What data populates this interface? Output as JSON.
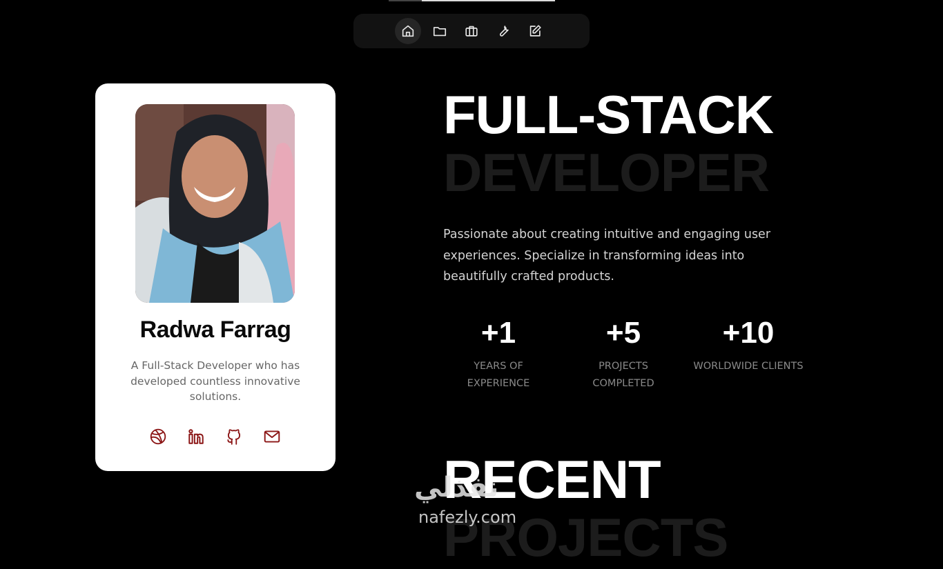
{
  "nav": {
    "items": [
      {
        "icon": "home-icon",
        "active": true
      },
      {
        "icon": "folder-icon",
        "active": false
      },
      {
        "icon": "briefcase-icon",
        "active": false
      },
      {
        "icon": "wrench-icon",
        "active": false
      },
      {
        "icon": "edit-icon",
        "active": false
      }
    ]
  },
  "profile": {
    "name": "Radwa Farrag",
    "bio": "A Full-Stack Developer who has developed countless innovative solutions.",
    "socials": [
      "dribbble-icon",
      "linkedin-icon",
      "github-icon",
      "mail-icon"
    ],
    "social_color": "#8b1515"
  },
  "hero": {
    "title_line1": "FULL-STACK",
    "title_line2": "DEVELOPER",
    "intro": "Passionate about creating intuitive and engaging user experiences. Specialize in transforming ideas into beautifully crafted products."
  },
  "stats": [
    {
      "value": "+1",
      "label_line1": "YEARS OF",
      "label_line2": "EXPERIENCE"
    },
    {
      "value": "+5",
      "label_line1": "PROJECTS",
      "label_line2": "COMPLETED"
    },
    {
      "value": "+10",
      "label_line1": "WORLDWIDE CLIENTS",
      "label_line2": ""
    }
  ],
  "recent": {
    "line1": "RECENT",
    "line2": "PROJECTS"
  },
  "watermark": {
    "arabic": "نفذلي",
    "latin": "nafezly.com"
  }
}
